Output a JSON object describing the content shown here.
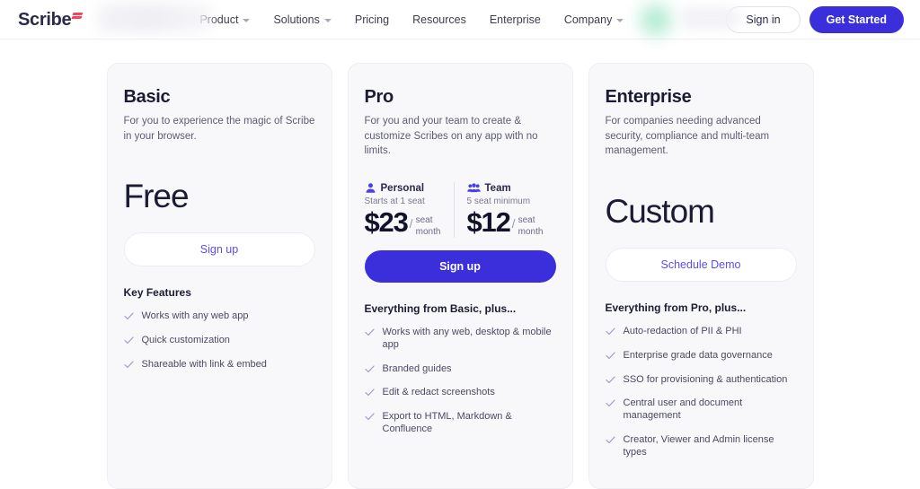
{
  "nav": {
    "logo_text": "Scribe",
    "links": [
      {
        "label": "Product",
        "has_caret": true
      },
      {
        "label": "Solutions",
        "has_caret": true
      },
      {
        "label": "Pricing",
        "has_caret": false
      },
      {
        "label": "Resources",
        "has_caret": false
      },
      {
        "label": "Enterprise",
        "has_caret": false
      },
      {
        "label": "Company",
        "has_caret": true
      }
    ],
    "sign_in": "Sign in",
    "get_started": "Get Started"
  },
  "colors": {
    "brand_indigo": "#3a2fdb",
    "link_purple": "#5b4df0",
    "logo_mark_pink": "#f6435f",
    "card_bg": "#f8f8fb",
    "heading": "#1b1b33"
  },
  "plans": [
    {
      "name": "Basic",
      "description": "For you to experience the magic of Scribe in your browser.",
      "price": "Free",
      "cta": "Sign up",
      "cta_style": "outline",
      "features_heading": "Key Features",
      "features": [
        "Works with any web app",
        "Quick customization",
        "Shareable with link & embed"
      ]
    },
    {
      "name": "Pro",
      "description": "For you and your team to create & customize Scribes on any app with no limits.",
      "price_columns": [
        {
          "icon": "person-icon",
          "label": "Personal",
          "note": "Starts at 1 seat",
          "amount": "$23",
          "per_unit": "seat",
          "per_period": "month"
        },
        {
          "icon": "people-icon",
          "label": "Team",
          "note": "5 seat minimum",
          "amount": "$12",
          "per_unit": "seat",
          "per_period": "month"
        }
      ],
      "cta": "Sign up",
      "cta_style": "solid",
      "features_heading": "Everything from Basic, plus...",
      "features": [
        "Works with any web, desktop & mobile app",
        "Branded guides",
        "Edit & redact screenshots",
        "Export to HTML, Markdown & Confluence"
      ]
    },
    {
      "name": "Enterprise",
      "description": "For companies needing advanced security, compliance and multi-team management.",
      "price": "Custom",
      "cta": "Schedule Demo",
      "cta_style": "outline",
      "features_heading": "Everything from Pro, plus...",
      "features": [
        "Auto-redaction of PII & PHI",
        "Enterprise grade data governance",
        "SSO for provisioning & authentication",
        "Central user and document management",
        "Creator, Viewer and Admin license types"
      ]
    }
  ]
}
